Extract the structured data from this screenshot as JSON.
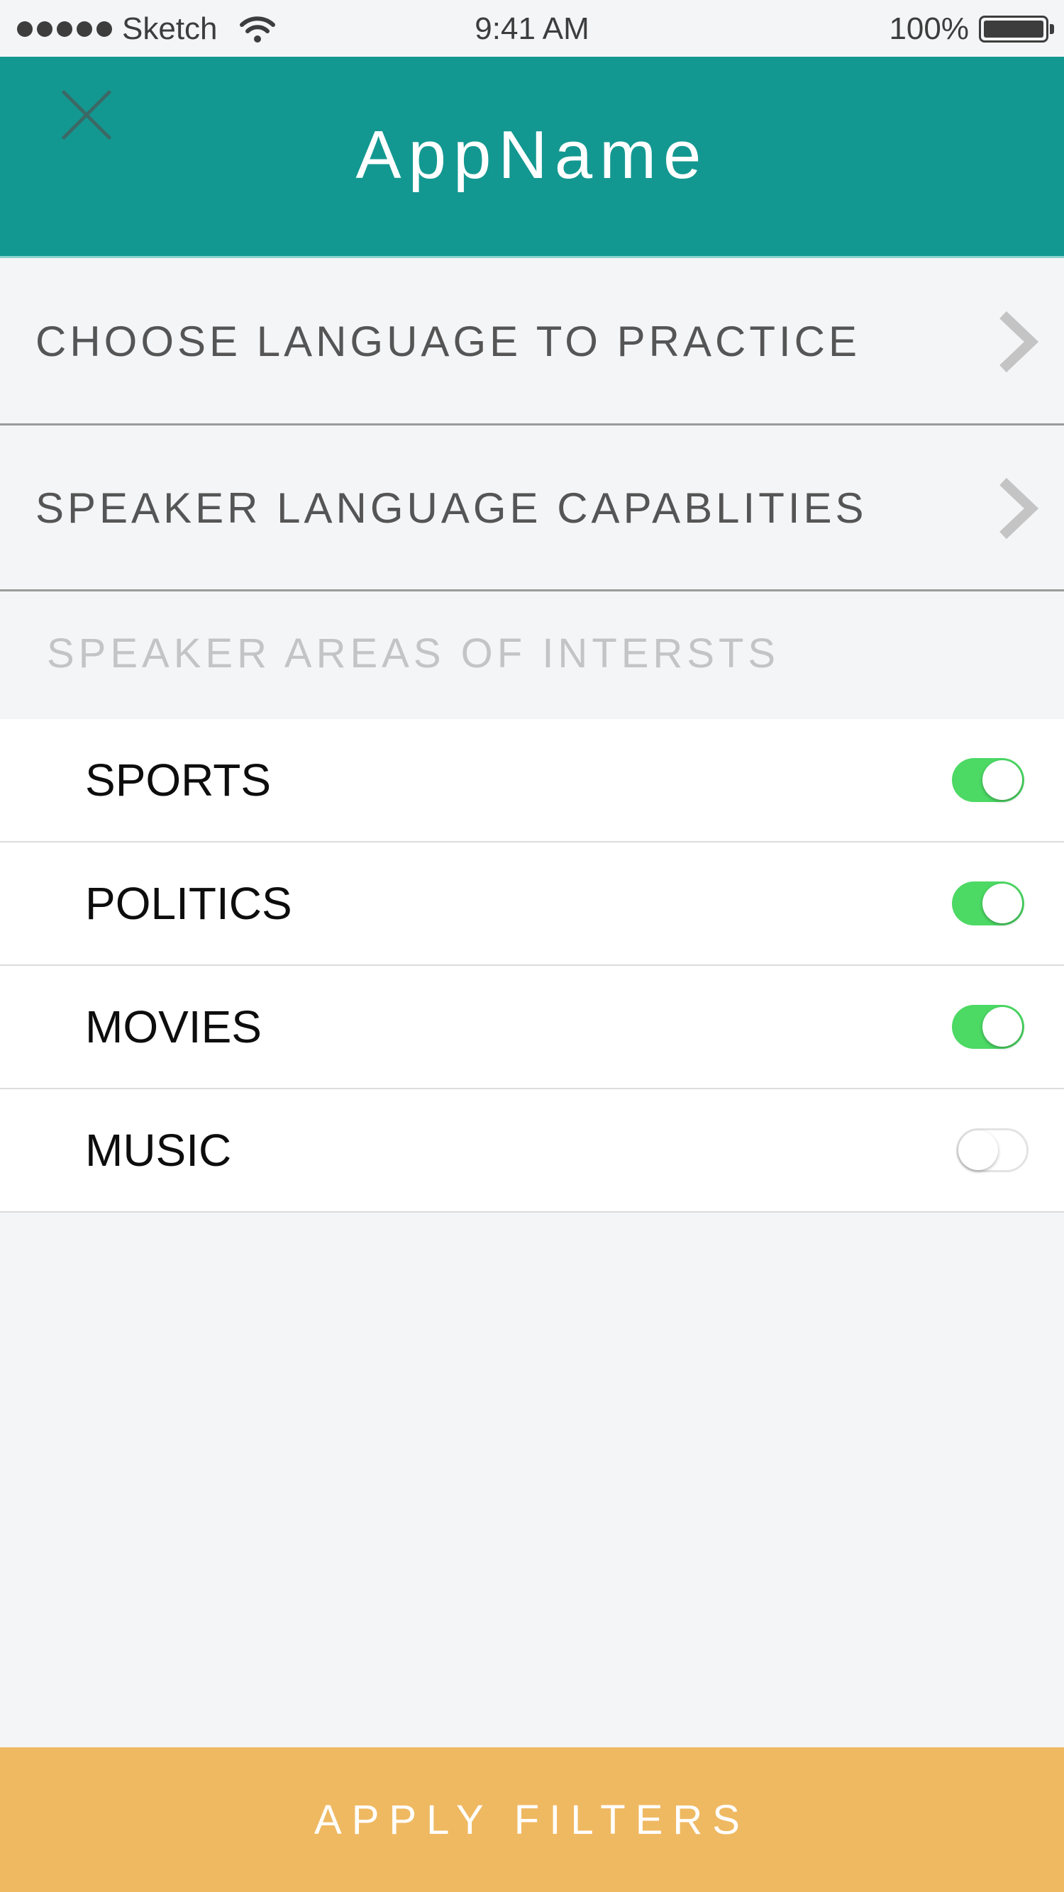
{
  "status_bar": {
    "carrier": "Sketch",
    "time": "9:41 AM",
    "battery": "100%"
  },
  "header": {
    "title": "AppName",
    "close_icon": "close-icon",
    "color": "#139891"
  },
  "nav": [
    {
      "label": "CHOOSE LANGUAGE TO PRACTICE",
      "icon": "chevron-right-icon"
    },
    {
      "label": "SPEAKER LANGUAGE CAPABLITIES",
      "icon": "chevron-right-icon"
    }
  ],
  "interests": {
    "section_title": "SPEAKER AREAS OF INTERSTS",
    "items": [
      {
        "label": "SPORTS",
        "enabled": true
      },
      {
        "label": "POLITICS",
        "enabled": true
      },
      {
        "label": "MOVIES",
        "enabled": true
      },
      {
        "label": "MUSIC",
        "enabled": false
      }
    ],
    "toggle_on_color": "#4cd964"
  },
  "apply_button": {
    "label": "APPLY FILTERS",
    "color": "#efb962"
  }
}
